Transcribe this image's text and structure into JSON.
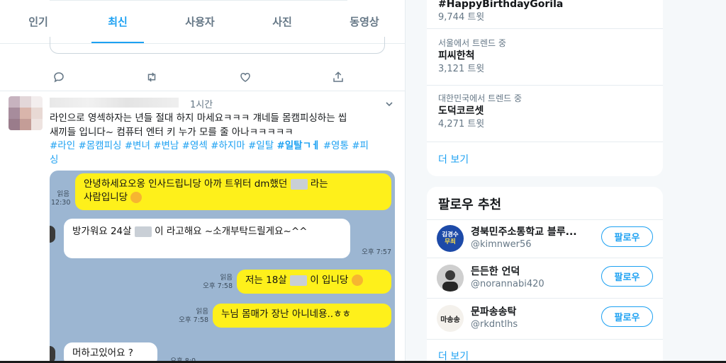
{
  "tabs": [
    {
      "label": "인기"
    },
    {
      "label": "최신"
    },
    {
      "label": "사용자"
    },
    {
      "label": "사진"
    },
    {
      "label": "동영상"
    }
  ],
  "active_tab": "최신",
  "tweet": {
    "time": "1시간",
    "text_line1": "라인으로 영섹하자는 년들 절대 하지 마세요ㅋㅋㅋ 걔네들 몸캠피싱하는 씹",
    "text_line2": "새끼들 입니다~ 컴퓨터 엔터 키 누가 모를 줄 아나ㅋㅋㅋㅋㅋ",
    "hashtags_line1": [
      "#라인",
      "#몸캠피싱",
      "#변녀",
      "#변남",
      "#영섹",
      "#하지마",
      "#일탈"
    ],
    "hashtag_bold": "#일탈ㄱㅔ",
    "hashtags_line1_end": [
      "#영통",
      "#피"
    ],
    "hashtags_line2": "싱",
    "chat": {
      "msg1_a": "안녕하세요오옹 인사드립니당 아까 트위터 dm했던",
      "msg1_b": "라는",
      "msg1_c": "사람입니당",
      "msg1_read": "읽음",
      "msg1_time": "12:30",
      "msg2_a": "방가워요 24살",
      "msg2_b": "이 라고해요 ~소개부탁드릴게요~^^",
      "msg2_time": "오후 7:57",
      "msg3_a": "저는 18살",
      "msg3_b": "이 입니당",
      "msg3_read": "읽음",
      "msg3_time": "오후 7:58",
      "msg4": "누님 몸매가 장난 아니네용..ㅎㅎ",
      "msg4_read": "읽음",
      "msg4_time": "오후 7:58",
      "msg5": "머하고있어요 ?",
      "msg5_time": "오후 8:0"
    }
  },
  "trends": [
    {
      "context": "",
      "name": "#HappyBirthdayGorila",
      "count": "9,744 트윗"
    },
    {
      "context": "서울에서 트렌드 중",
      "name": "피씨한척",
      "count": "3,121 트윗"
    },
    {
      "context": "대한민국에서 트렌드 중",
      "name": "도덕코르셋",
      "count": "4,271 트윗"
    }
  ],
  "trends_more": "더 보기",
  "who_to_follow": {
    "title": "팔로우 추천",
    "accounts": [
      {
        "name": "경북민주소통학교 블루...",
        "handle": "@kimnwer56",
        "avatar_text_1": "김경수",
        "avatar_text_2": "무죄",
        "button": "팔로우"
      },
      {
        "name": "든든한 언덕",
        "handle": "@norannabi420",
        "button": "팔로우"
      },
      {
        "name": "문파송송탁",
        "handle": "@rkdntlhs",
        "avatar_text_1": "마송송",
        "button": "팔로우"
      }
    ],
    "more": "더 보기"
  },
  "colors": {
    "accent": "#1da1f2",
    "chat_yellow": "#fef01b",
    "chat_bg": "#9cb6d2"
  }
}
